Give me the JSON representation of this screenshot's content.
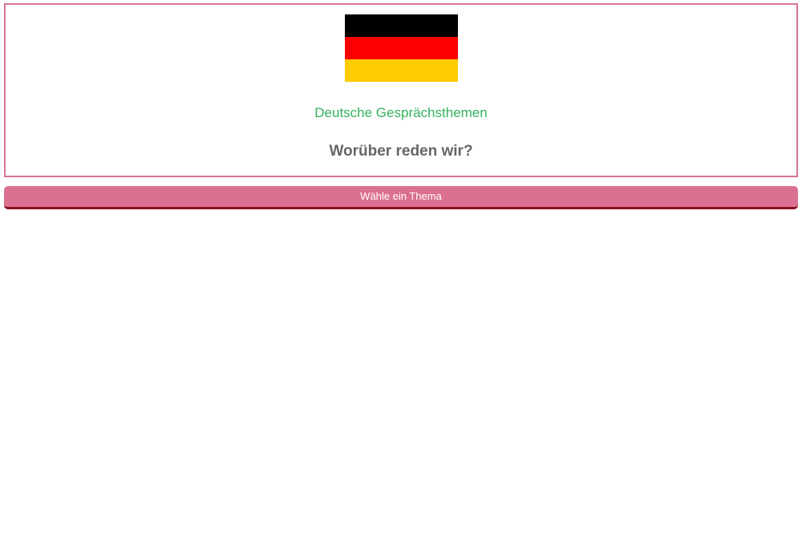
{
  "header": {
    "flag": {
      "icon": "germany-flag-icon",
      "colors": [
        "#000000",
        "#ff0000",
        "#ffcc00"
      ]
    },
    "subtitle": "Deutsche Gesprächsthemen",
    "question": "Worüber reden wir?"
  },
  "actions": {
    "choose_topic_label": "Wähle ein Thema"
  },
  "colors": {
    "accent": "#db7090",
    "border": "#d87592",
    "subtitle_text": "#33b25e",
    "question_text": "#666666",
    "button_shadow": "#8a1020"
  }
}
